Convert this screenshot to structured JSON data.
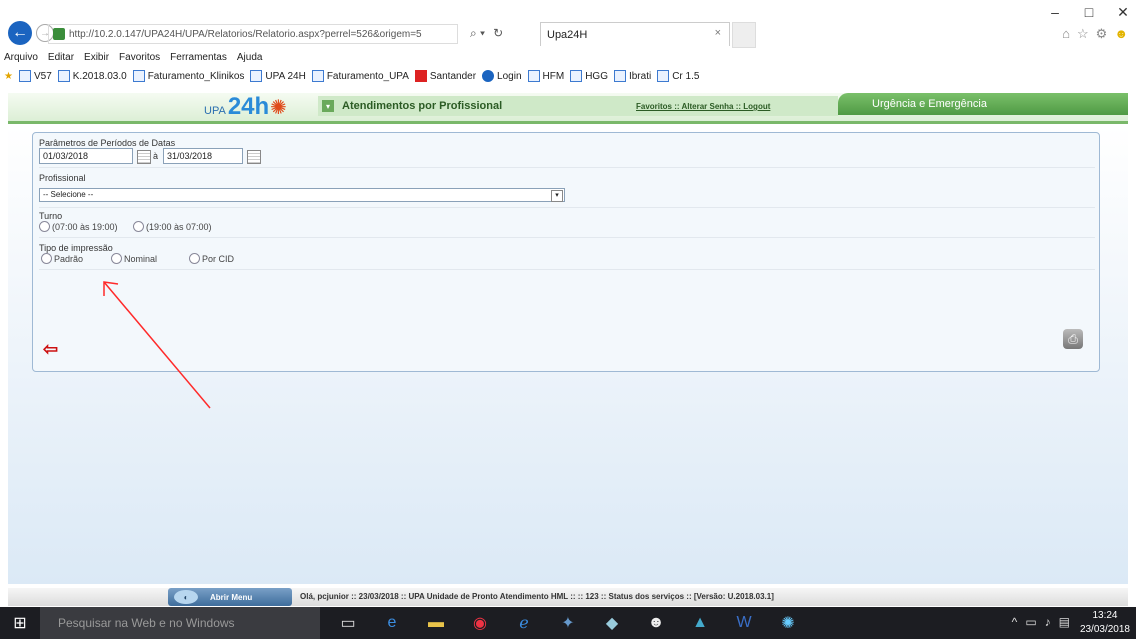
{
  "window": {
    "minimize": "–",
    "maximize": "□",
    "close": "✕"
  },
  "browser": {
    "url": "http://10.2.0.147/UPA24H/UPA/Relatorios/Relatorio.aspx?perrel=526&origem=5",
    "search_glyph": "⌕ ▾",
    "refresh_glyph": "↻",
    "tab_title": "Upa24H",
    "tab_close": "×",
    "toolbar_icons": {
      "home": "⌂",
      "favorites": "☆",
      "settings": "⚙",
      "feedback": "☻"
    }
  },
  "menubar": [
    "Arquivo",
    "Editar",
    "Exibir",
    "Favoritos",
    "Ferramentas",
    "Ajuda"
  ],
  "favorites": [
    {
      "label": "V57",
      "icon": "page-icon"
    },
    {
      "label": "K.2018.03.0",
      "icon": "page-icon"
    },
    {
      "label": "Faturamento_Klinikos",
      "icon": "page-icon"
    },
    {
      "label": "UPA 24H",
      "icon": "page-icon"
    },
    {
      "label": "Faturamento_UPA",
      "icon": "page-icon"
    },
    {
      "label": "Santander",
      "icon": "santander-icon"
    },
    {
      "label": "Login",
      "icon": "login-icon"
    },
    {
      "label": "HFM",
      "icon": "page-icon"
    },
    {
      "label": "HGG",
      "icon": "page-icon"
    },
    {
      "label": "Ibrati",
      "icon": "page-icon"
    },
    {
      "label": "Cr 1.5",
      "icon": "page-icon"
    }
  ],
  "app": {
    "logo_prefix": "UPA",
    "logo_main": "24h",
    "page_title": "Atendimentos por Profissional",
    "header_links": "Favoritos :: Alterar Senha :: Logout",
    "section_right": "Urgência e Emergência"
  },
  "form": {
    "period_label": "Parâmetros de Períodos de Datas",
    "date_from": "01/03/2018",
    "date_sep": "à",
    "date_to": "31/03/2018",
    "professional_label": "Profissional",
    "professional_selected": "-- Selecione --",
    "turno_label": "Turno",
    "turno_options": [
      "(07:00 às 19:00)",
      "(19:00 às 07:00)"
    ],
    "tipo_label": "Tipo de impressão",
    "tipo_options": [
      "Padrão",
      "Nominal",
      "Por CID"
    ]
  },
  "statusbar": {
    "menu_button": "Abrir Menu",
    "text": "Olá, pcjunior  ::  23/03/2018  ::  UPA Unidade de Pronto Atendimento HML  ::    ::  123  ::    Status dos serviços    ::  [Versão: U.2018.03.1]"
  },
  "taskbar": {
    "search_placeholder": "Pesquisar na Web e no Windows",
    "time": "13:24",
    "date": "23/03/2018",
    "apps": [
      "task-view-icon",
      "edge-icon",
      "explorer-icon",
      "chrome-icon",
      "ie-icon",
      "app-icon",
      "app-icon",
      "app-icon",
      "app-icon",
      "word-icon",
      "app-icon"
    ]
  },
  "colors": {
    "accent_green": "#7ab86a",
    "annotation_arrow": "#ff2a2a",
    "header_blue": "#2a8bd8"
  }
}
